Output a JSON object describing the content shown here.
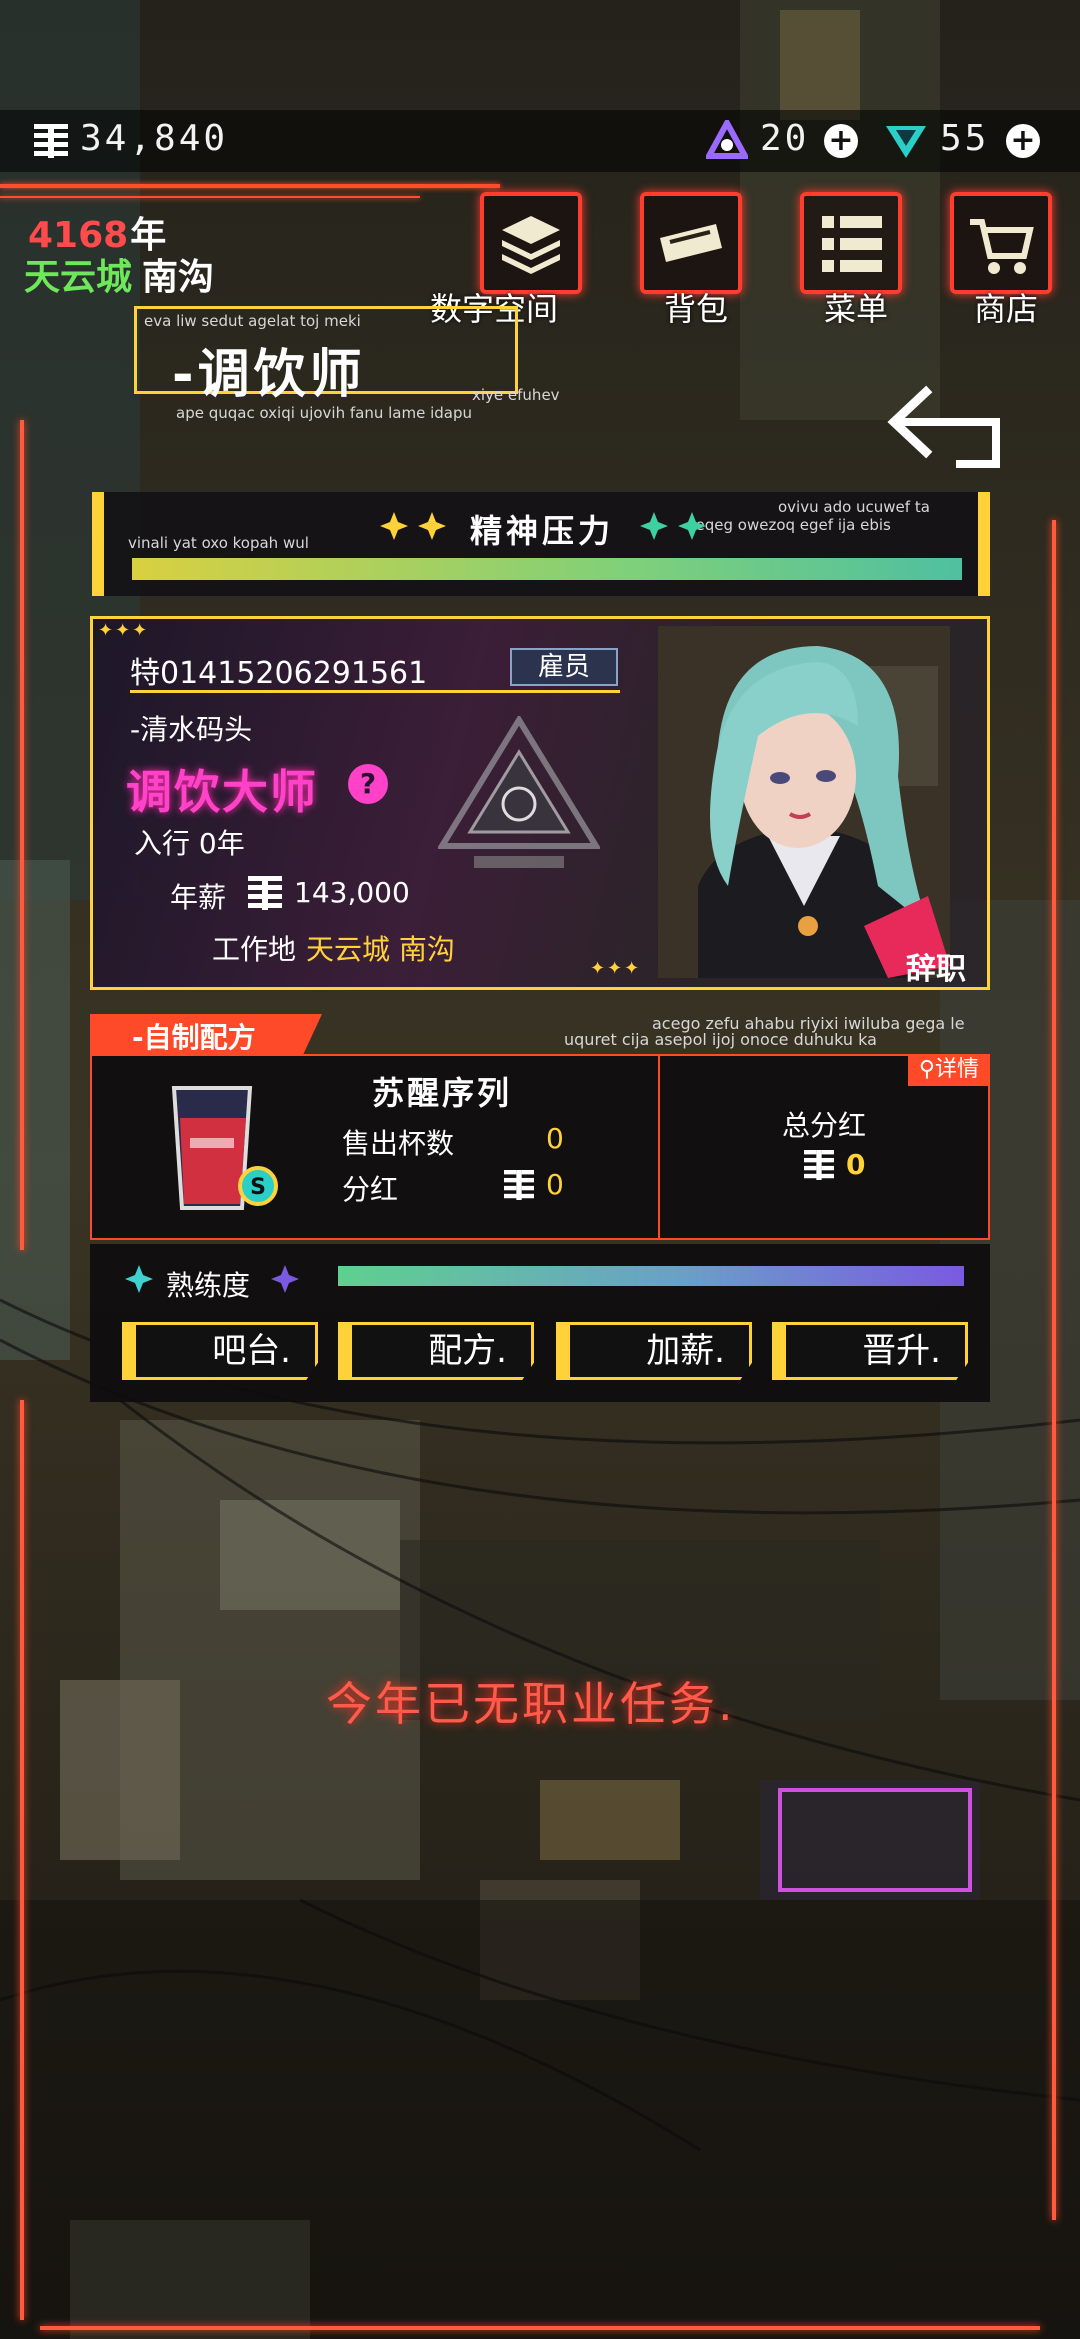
{
  "topbar": {
    "coins": "34,840",
    "gems": "20",
    "crystals": "55"
  },
  "status": {
    "year": "4168",
    "year_unit": "年",
    "city": "天云城",
    "district": "南沟"
  },
  "nav": [
    {
      "label": "数字空间",
      "icon": "data-stack-icon"
    },
    {
      "label": "背包",
      "icon": "bag-icon"
    },
    {
      "label": "菜单",
      "icon": "menu-list-icon"
    },
    {
      "label": "商店",
      "icon": "cart-icon"
    }
  ],
  "header": {
    "title": "-调饮师",
    "flavor_top": "eva liw sedut agelat toj meki",
    "flavor_right": "xiye efuhev",
    "flavor_bottom": "ape quqac oxiqi ujovih fanu lame idapu"
  },
  "stress": {
    "label": "精神压力",
    "flavor_left": "vinali yat oxo kopah wul",
    "flavor_right_1": "ovivu ado ucuwef ta",
    "flavor_right_2": "qeqeg owezoq egef ija ebis",
    "level_percent": 100
  },
  "profile": {
    "id": "特01415206291561",
    "role_tag": "雇员",
    "prev_place": "-清水码头",
    "rank": "调饮大师",
    "help_symbol": "?",
    "years_in_trade": "入行 0年",
    "salary_label": "年薪",
    "salary": "143,000",
    "workplace_label": "工作地",
    "workplace": "天云城 南沟",
    "resign_label": "辞职"
  },
  "recipe": {
    "tab_label": "-自制配方",
    "flavor_1": "acego zefu ahabu riyixi iwiluba gega le",
    "flavor_2": "uquret cija asepol ijoj onoce duhuku ka",
    "name": "苏醒序列",
    "sold_label": "售出杯数",
    "sold": "0",
    "dividend_label": "分红",
    "dividend": "0",
    "detail_label": "详情",
    "total_label": "总分红",
    "total": "0"
  },
  "proficiency": {
    "label": "熟练度",
    "level_percent": 100
  },
  "actions": [
    {
      "label": "吧台."
    },
    {
      "label": "配方."
    },
    {
      "label": "加薪."
    },
    {
      "label": "晋升."
    }
  ],
  "message": "今年已无职业任务.",
  "colors": {
    "accent_red": "#ff4a2a",
    "accent_yellow": "#ffd23a",
    "rank_magenta": "#ff42c8",
    "city_green": "#6ee85a"
  }
}
